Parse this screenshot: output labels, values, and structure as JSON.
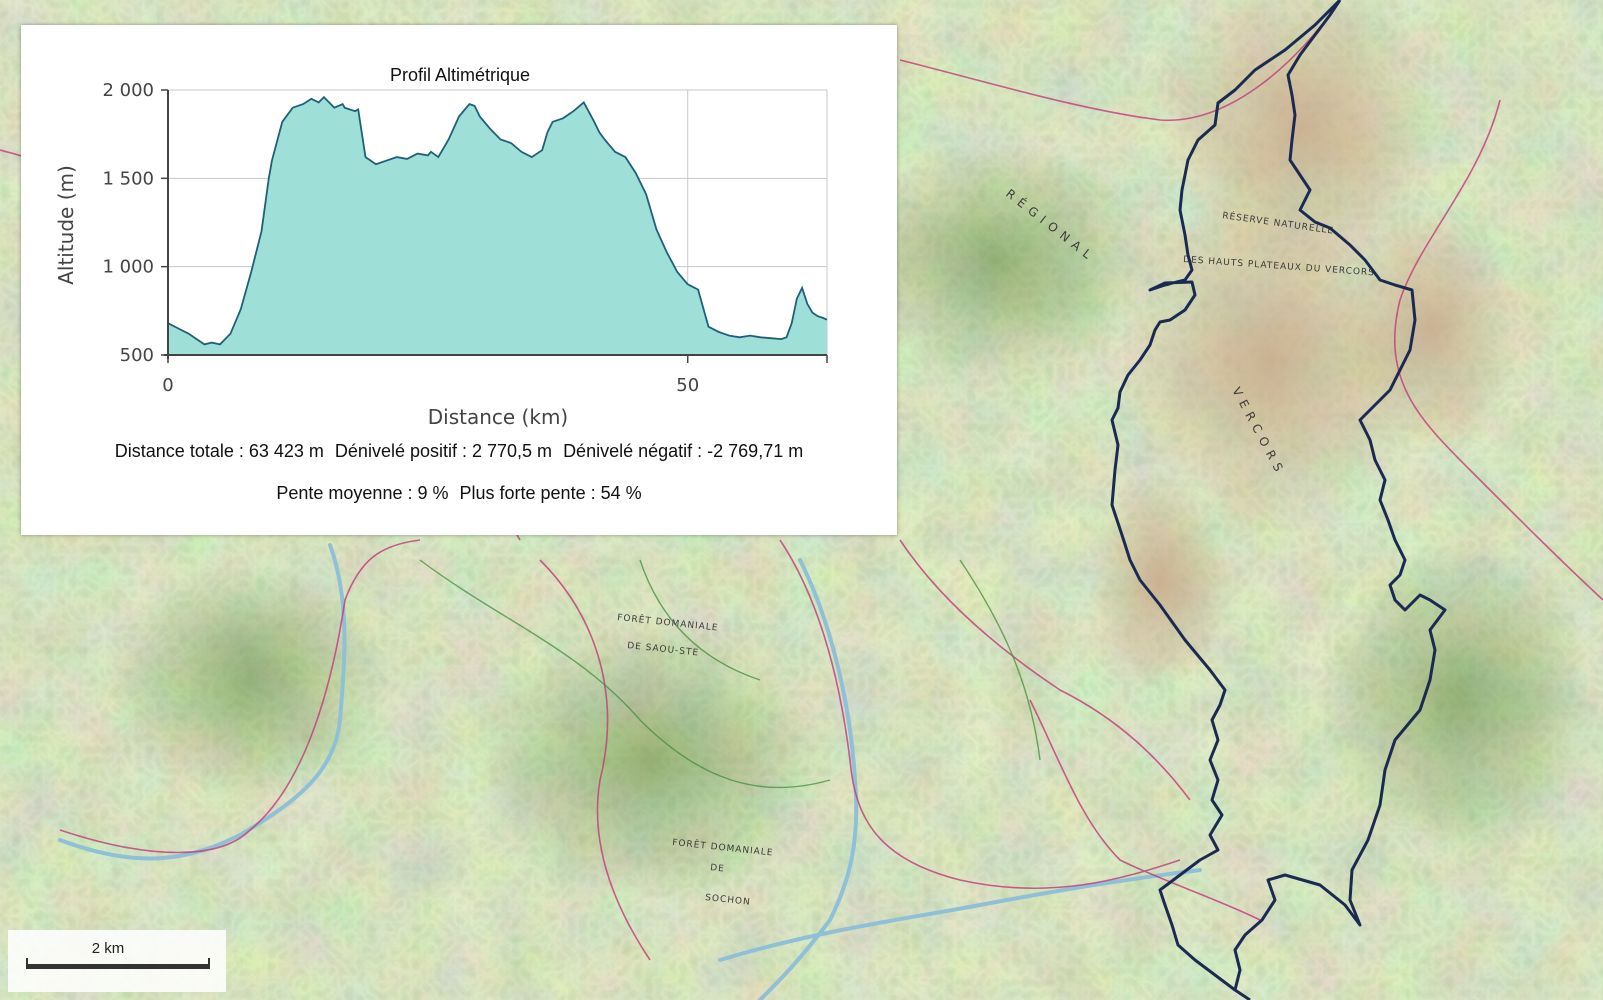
{
  "map": {
    "labels": {
      "reserve_line1": "RÉSERVE NATURELLE",
      "reserve_line2": "DES HAUTS PLATEAUX DU VERCORS",
      "vercors": "VERCORS",
      "regional": "RÉGIONAL",
      "foret_domaniale_1": "FORÊT DOMANIALE",
      "foret_domaniale_1b": "DE SAOU-STE",
      "foret_domaniale_2": "FORÊT DOMANIALE",
      "foret_domaniale_2b": "DE",
      "foret_domaniale_2c": "SOCHON"
    },
    "colors": {
      "route": "#1a2a52",
      "terrain": "#b9cf93",
      "relief": "#c9a98a",
      "roads": "#c0397a",
      "river": "#8fc0d8"
    },
    "scale_label": "2 km"
  },
  "profile": {
    "title": "Profil Altimétrique",
    "stats_line1": [
      "Distance totale : 63 423 m",
      "Dénivelé positif : 2 770,5 m",
      "Dénivelé négatif : -2 769,71 m"
    ],
    "stats_line2": [
      "Pente moyenne : 9 %",
      "Plus forte pente : 54 %"
    ]
  },
  "chart_data": {
    "type": "area",
    "title": "Profil Altimétrique",
    "xlabel": "Distance (km)",
    "ylabel": "Altitude (m)",
    "xlim": [
      0,
      63.4
    ],
    "ylim": [
      500,
      2000
    ],
    "x_ticks": [
      0,
      50
    ],
    "x_tick_labels": [
      "0",
      "50"
    ],
    "y_ticks": [
      500,
      1000,
      1500,
      2000
    ],
    "y_tick_labels": [
      "500",
      "1 000",
      "1 500",
      "2 000"
    ],
    "grid": true,
    "fill_color": "#9ee0d8",
    "line_color": "#1f5f7a",
    "x": [
      0,
      1,
      2,
      3,
      3.5,
      4.2,
      5,
      6,
      7,
      8,
      9,
      9.7,
      10,
      11,
      12,
      13,
      13.8,
      14.5,
      15,
      15.5,
      16,
      16.8,
      17,
      18,
      18.3,
      19,
      20,
      21,
      22,
      23,
      24,
      25,
      25.3,
      26,
      27,
      28,
      29,
      29.5,
      30,
      31,
      32,
      33,
      34,
      35,
      36,
      36.5,
      37,
      38,
      39,
      40,
      41,
      41.5,
      42,
      43,
      44,
      45,
      46,
      47,
      48,
      49,
      50,
      51,
      52,
      53,
      53.5,
      54,
      55,
      56,
      57,
      58,
      59,
      59.5,
      60,
      60.5,
      61,
      61.5,
      62,
      62.5,
      63,
      63.4
    ],
    "y": [
      680,
      650,
      620,
      580,
      560,
      570,
      560,
      620,
      760,
      970,
      1200,
      1500,
      1600,
      1820,
      1900,
      1920,
      1950,
      1930,
      1960,
      1930,
      1900,
      1920,
      1900,
      1880,
      1890,
      1620,
      1580,
      1600,
      1620,
      1610,
      1640,
      1630,
      1650,
      1620,
      1720,
      1850,
      1920,
      1910,
      1850,
      1780,
      1720,
      1700,
      1650,
      1620,
      1660,
      1760,
      1820,
      1840,
      1880,
      1930,
      1820,
      1760,
      1720,
      1650,
      1620,
      1530,
      1410,
      1210,
      1080,
      970,
      900,
      870,
      660,
      630,
      620,
      610,
      600,
      610,
      600,
      595,
      590,
      600,
      680,
      820,
      880,
      790,
      740,
      720,
      710,
      700
    ]
  }
}
